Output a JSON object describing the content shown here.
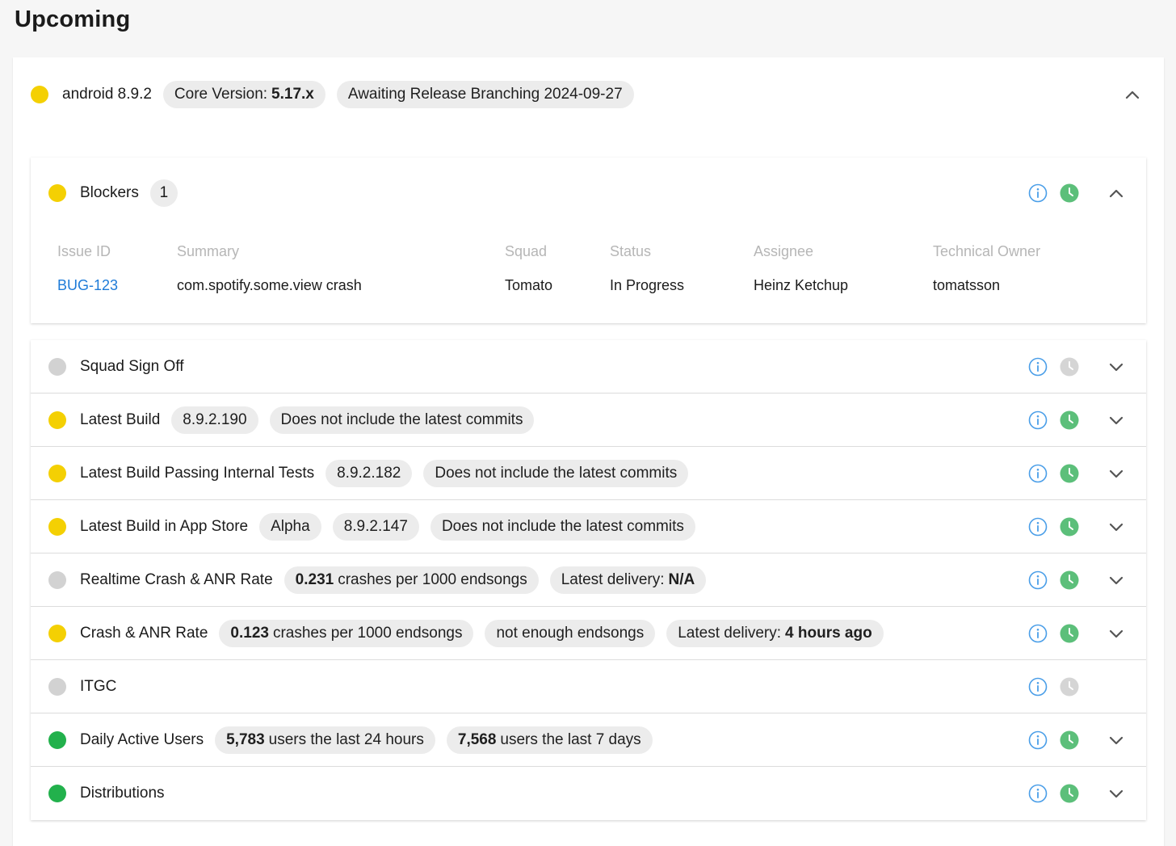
{
  "page_title": "Upcoming",
  "release": {
    "status_color": "#f4d003",
    "name": "android 8.9.2",
    "core_version_label": "Core Version:",
    "core_version_value": "5.17.x",
    "state": "Awaiting Release Branching 2024-09-27"
  },
  "blockers": {
    "label": "Blockers",
    "count": "1",
    "columns": [
      "Issue ID",
      "Summary",
      "Squad",
      "Status",
      "Assignee",
      "Technical Owner"
    ],
    "rows": [
      [
        "BUG-123",
        "com.spotify.some.view crash",
        "Tomato",
        "In Progress",
        "Heinz Ketchup",
        "tomatsson"
      ]
    ]
  },
  "checks": [
    {
      "label": "Squad Sign Off",
      "status": "gray",
      "clock": "gray",
      "chevron": true,
      "chips": []
    },
    {
      "label": "Latest Build",
      "status": "yellow",
      "clock": "green",
      "chevron": true,
      "chips": [
        {
          "text": "8.9.2.190"
        },
        {
          "text": "Does not include the latest commits"
        }
      ]
    },
    {
      "label": "Latest Build Passing Internal Tests",
      "status": "yellow",
      "clock": "green",
      "chevron": true,
      "chips": [
        {
          "text": "8.9.2.182"
        },
        {
          "text": "Does not include the latest commits"
        }
      ]
    },
    {
      "label": "Latest Build in App Store",
      "status": "yellow",
      "clock": "green",
      "chevron": true,
      "chips": [
        {
          "text": "Alpha"
        },
        {
          "text": "8.9.2.147"
        },
        {
          "text": "Does not include the latest commits"
        }
      ]
    },
    {
      "label": "Realtime Crash & ANR Rate",
      "status": "gray",
      "clock": "green",
      "chevron": true,
      "chips": [
        {
          "bold": "0.231",
          "text": "crashes per 1000 endsongs"
        },
        {
          "text": "Latest delivery:",
          "bold_after": "N/A"
        }
      ]
    },
    {
      "label": "Crash & ANR Rate",
      "status": "yellow",
      "clock": "green",
      "chevron": true,
      "chips": [
        {
          "bold": "0.123",
          "text": "crashes per 1000 endsongs"
        },
        {
          "text": "not enough endsongs"
        },
        {
          "text": "Latest delivery:",
          "bold_after": "4 hours ago"
        }
      ]
    },
    {
      "label": "ITGC",
      "status": "gray",
      "clock": "gray",
      "chevron": false,
      "chips": []
    },
    {
      "label": "Daily Active Users",
      "status": "green",
      "clock": "green",
      "chevron": true,
      "chips": [
        {
          "bold": "5,783",
          "text": "users the last 24 hours"
        },
        {
          "bold": "7,568",
          "text": "users the last 7 days"
        }
      ]
    },
    {
      "label": "Distributions",
      "status": "green",
      "clock": "green",
      "chevron": true,
      "chips": []
    }
  ],
  "colors": {
    "yellow": "#f4d003",
    "gray": "#d2d2d2",
    "green": "#22b14c",
    "clock_green": "#5cbf7a",
    "clock_gray": "#d5d5d5",
    "info_blue": "#4a9ee8",
    "link_blue": "#1e7bd8"
  }
}
